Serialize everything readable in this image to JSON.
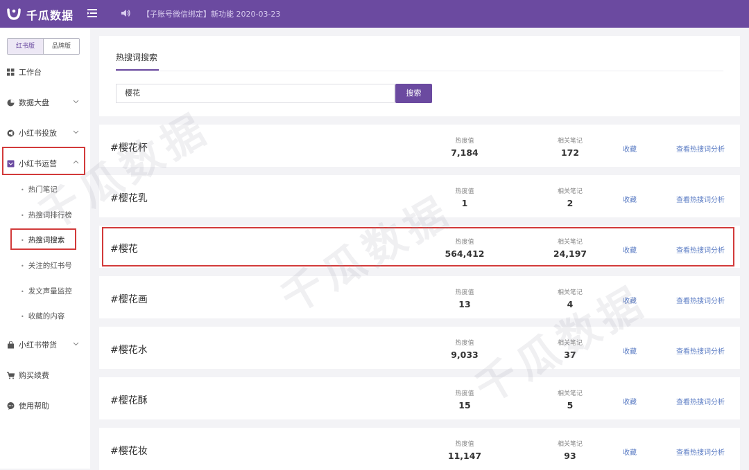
{
  "header": {
    "brand": "千瓜数据",
    "announcement": "【子账号微信绑定】新功能  2020-03-23"
  },
  "sidebar": {
    "versions": [
      "红书版",
      "品牌版"
    ],
    "items": [
      {
        "label": "工作台",
        "icon": "dashboard-icon"
      },
      {
        "label": "数据大盘",
        "icon": "pie-icon"
      },
      {
        "label": "小红书投放",
        "icon": "megaphone-icon"
      },
      {
        "label": "小红书运营",
        "icon": "operation-icon"
      },
      {
        "label": "小红书带货",
        "icon": "bag-icon"
      },
      {
        "label": "购买续费",
        "icon": "cart-icon"
      },
      {
        "label": "使用帮助",
        "icon": "help-icon"
      }
    ],
    "sub_items": [
      "热门笔记",
      "热搜词排行榜",
      "热搜词搜索",
      "关注的红书号",
      "发文声量监控",
      "收藏的内容"
    ]
  },
  "main": {
    "tab": "热搜词搜索",
    "search": {
      "value": "樱花",
      "button": "搜索"
    },
    "labels": {
      "heat": "热度值",
      "notes": "相关笔记",
      "favorite": "收藏",
      "analyze": "查看热搜词分析"
    },
    "results": [
      {
        "keyword": "#樱花杯",
        "heat": "7,184",
        "notes": "172"
      },
      {
        "keyword": "#樱花乳",
        "heat": "1",
        "notes": "2"
      },
      {
        "keyword": "#樱花",
        "heat": "564,412",
        "notes": "24,197"
      },
      {
        "keyword": "#樱花画",
        "heat": "13",
        "notes": "4"
      },
      {
        "keyword": "#樱花水",
        "heat": "9,033",
        "notes": "37"
      },
      {
        "keyword": "#樱花酥",
        "heat": "15",
        "notes": "5"
      },
      {
        "keyword": "#樱花妆",
        "heat": "11,147",
        "notes": "93"
      }
    ]
  },
  "watermark": "千瓜数据",
  "colors": {
    "brand": "#6b4aa0",
    "link": "#5b7cc4",
    "highlight": "#d23a3a"
  }
}
